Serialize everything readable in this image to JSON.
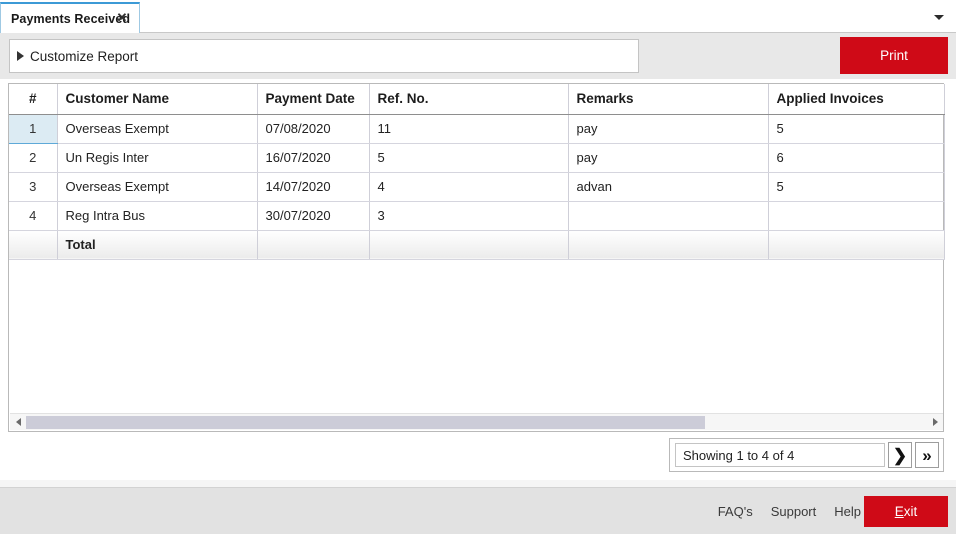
{
  "window": {
    "tab": {
      "label": "Payments Received",
      "close_icon": "close-icon"
    },
    "tab_dropdown_icon": "chevron-down-icon"
  },
  "toolbar": {
    "customize_report_label": "Customize Report",
    "customize_report_icon": "triangle-right-icon",
    "print_label": "Print"
  },
  "grid": {
    "columns": [
      {
        "key": "num",
        "label": "#"
      },
      {
        "key": "name",
        "label": "Customer Name"
      },
      {
        "key": "date",
        "label": "Payment Date"
      },
      {
        "key": "ref",
        "label": "Ref. No."
      },
      {
        "key": "remarks",
        "label": "Remarks"
      },
      {
        "key": "invoices",
        "label": "Applied Invoices"
      }
    ],
    "rows": [
      {
        "num": "1",
        "name": "Overseas Exempt",
        "date": "07/08/2020",
        "ref": "11",
        "remarks": "pay",
        "invoices": "5"
      },
      {
        "num": "2",
        "name": "Un Regis Inter",
        "date": "16/07/2020",
        "ref": "5",
        "remarks": "pay",
        "invoices": "6"
      },
      {
        "num": "3",
        "name": "Overseas Exempt",
        "date": "14/07/2020",
        "ref": "4",
        "remarks": "advan",
        "invoices": "5"
      },
      {
        "num": "4",
        "name": "Reg Intra Bus",
        "date": "30/07/2020",
        "ref": "3",
        "remarks": "",
        "invoices": ""
      }
    ],
    "total_row": {
      "num": "",
      "name": "Total",
      "date": "",
      "ref": "",
      "remarks": "",
      "invoices": ""
    },
    "selected_row_index": 0
  },
  "scrollbar": {
    "left_arrow_icon": "arrow-left-icon",
    "right_arrow_icon": "arrow-right-icon"
  },
  "pager": {
    "status": "Showing 1 to 4 of 4",
    "next_label": "❯",
    "last_label": "»"
  },
  "footer": {
    "links": [
      {
        "label": "FAQ's"
      },
      {
        "label": "Support"
      },
      {
        "label": "Help"
      }
    ],
    "exit_accel": "E",
    "exit_rest": "xit"
  },
  "colors": {
    "accent_red": "#cf0a17",
    "tab_active_border": "#3c9ad6",
    "row_selected": "#dcebf3"
  }
}
